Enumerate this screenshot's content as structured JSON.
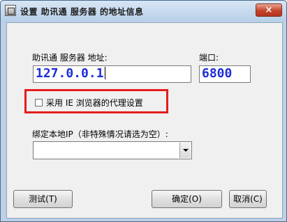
{
  "title": "设置 助讯通 服务器 的地址信息",
  "close_glyph": "×",
  "server": {
    "label": "助讯通 服务器 地址:",
    "value": "127.0.0.1"
  },
  "port": {
    "label": "端口:",
    "value": "6800"
  },
  "proxy_checkbox": {
    "label": "采用 IE 浏览器的代理设置",
    "checked": false
  },
  "bind_ip": {
    "label": "绑定本地IP（非特殊情况请选为空）:",
    "selected": ""
  },
  "buttons": {
    "test": "测试(T)",
    "ok": "确定(O)",
    "cancel": "取消(C)"
  },
  "colors": {
    "value_text": "#1e2dd6",
    "highlight": "#e41c1c"
  }
}
